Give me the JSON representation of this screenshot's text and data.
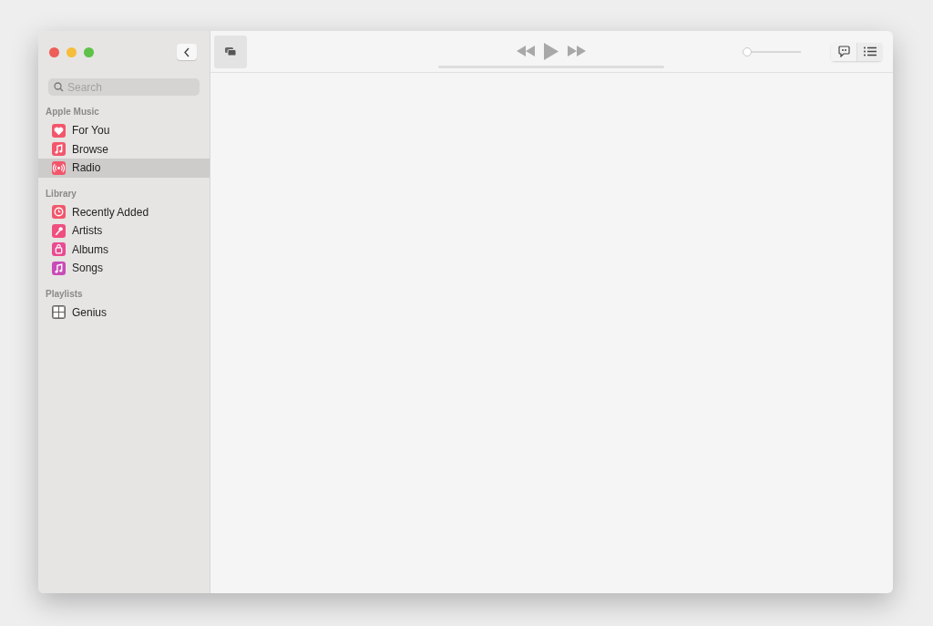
{
  "search": {
    "placeholder": "Search"
  },
  "sidebar": {
    "sections": [
      {
        "title": "Apple Music",
        "items": [
          {
            "label": "For You",
            "kind": "heart",
            "color": "#f2566b",
            "selected": false
          },
          {
            "label": "Browse",
            "kind": "note",
            "color": "#f2566b",
            "selected": false
          },
          {
            "label": "Radio",
            "kind": "radio",
            "color": "#f2566b",
            "selected": true
          }
        ]
      },
      {
        "title": "Library",
        "items": [
          {
            "label": "Recently Added",
            "kind": "clock",
            "color": "#f2566b",
            "selected": false
          },
          {
            "label": "Artists",
            "kind": "mic",
            "color": "#ee4f7f",
            "selected": false
          },
          {
            "label": "Albums",
            "kind": "album",
            "color": "#e94b90",
            "selected": false
          },
          {
            "label": "Songs",
            "kind": "note",
            "color": "#c94bb8",
            "selected": false
          }
        ]
      },
      {
        "title": "Playlists",
        "items": [
          {
            "label": "Genius",
            "kind": "grid",
            "color": "#666666",
            "selected": false
          }
        ]
      }
    ]
  },
  "player": {
    "volume": {
      "level": 0.0
    }
  }
}
